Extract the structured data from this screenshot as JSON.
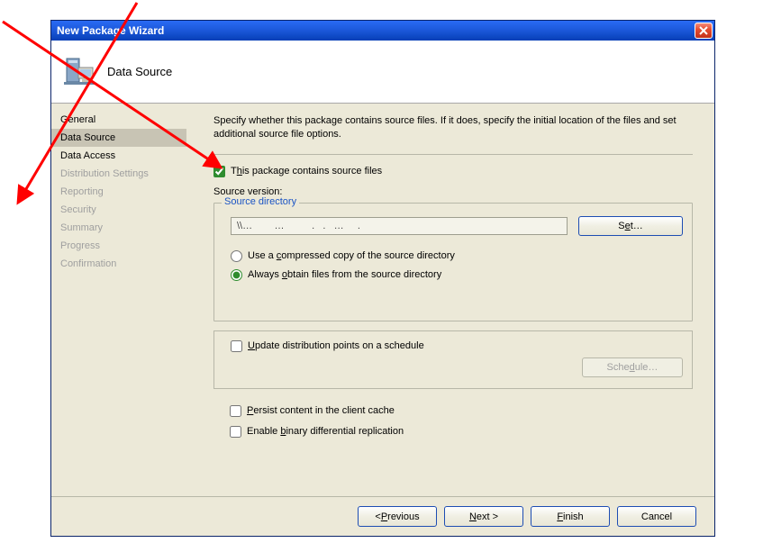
{
  "window": {
    "title": "New Package Wizard"
  },
  "header": {
    "pageTitle": "Data Source"
  },
  "sidebar": {
    "items": [
      {
        "label": "General",
        "state": "enabled"
      },
      {
        "label": "Data Source",
        "state": "active"
      },
      {
        "label": "Data Access",
        "state": "enabled"
      },
      {
        "label": "Distribution Settings",
        "state": "disabled"
      },
      {
        "label": "Reporting",
        "state": "disabled"
      },
      {
        "label": "Security",
        "state": "disabled"
      },
      {
        "label": "Summary",
        "state": "disabled"
      },
      {
        "label": "Progress",
        "state": "disabled"
      },
      {
        "label": "Confirmation",
        "state": "disabled"
      }
    ]
  },
  "content": {
    "instructions": "Specify whether this package contains source files. If it does, specify the initial location of the files and set additional source file options.",
    "containsSourceCheck": {
      "checked": true
    },
    "containsSourceLabel_pre": "T",
    "containsSourceLabel_u": "h",
    "containsSourceLabel_post": "is package contains source files",
    "sourceVersionLabel": "Source version:",
    "sourceDirLegend": "Source directory",
    "pathValue": "\\\\…        …          .   .   …     .",
    "setButton_pre": "S",
    "setButton_u": "e",
    "setButton_post": "t…",
    "optCompressed_pre": "Use a ",
    "optCompressed_u": "c",
    "optCompressed_post": "ompressed copy of the source directory",
    "optAlways_pre": "Always ",
    "optAlways_u": "o",
    "optAlways_post": "btain files from the source directory",
    "sourceOption": "always",
    "updateSched_pre": "",
    "updateSched_u": "U",
    "updateSched_post": "pdate distribution points on a schedule",
    "updateSchedChecked": false,
    "scheduleBtn_pre": "Sche",
    "scheduleBtn_u": "d",
    "scheduleBtn_post": "ule…",
    "persist_pre": "",
    "persist_u": "P",
    "persist_post": "ersist content in the client cache",
    "persistChecked": false,
    "binary_pre": "Enable ",
    "binary_u": "b",
    "binary_post": "inary differential replication",
    "binaryChecked": false
  },
  "footer": {
    "prev_pre": "< ",
    "prev_u": "P",
    "prev_post": "revious",
    "next_pre": "",
    "next_u": "N",
    "next_post": "ext >",
    "finish_pre": "",
    "finish_u": "F",
    "finish_post": "inish",
    "cancel": "Cancel"
  }
}
